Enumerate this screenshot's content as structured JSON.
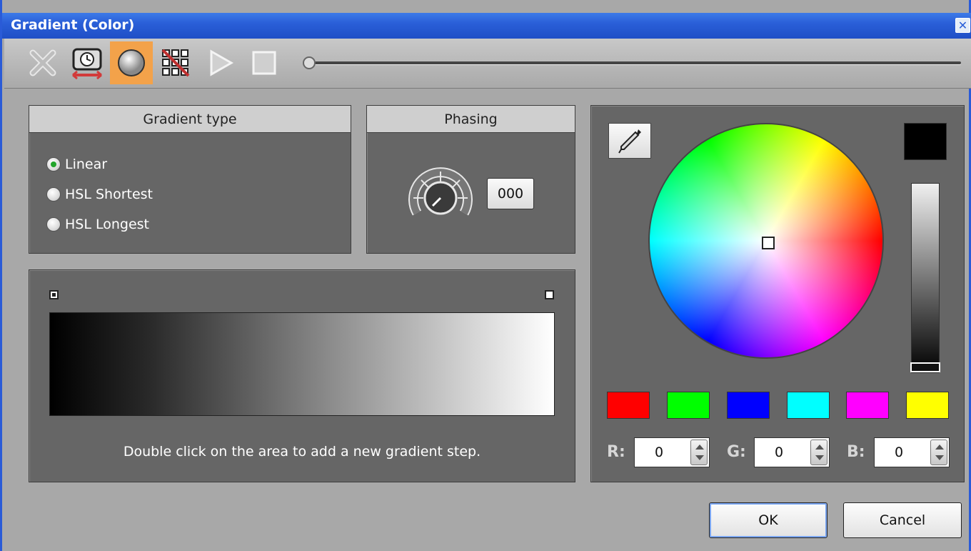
{
  "window": {
    "title": "Gradient (Color)",
    "close_glyph": "✕"
  },
  "toolbar": {
    "icons": [
      "delete-icon",
      "timer-icon",
      "gradient-icon",
      "pattern-icon",
      "play-icon",
      "stop-icon"
    ],
    "active": "gradient-icon",
    "slider_value": 0
  },
  "gradient_type": {
    "header": "Gradient type",
    "options": [
      {
        "label": "Linear",
        "selected": true
      },
      {
        "label": "HSL Shortest",
        "selected": false
      },
      {
        "label": "HSL Longest",
        "selected": false
      }
    ]
  },
  "phasing": {
    "header": "Phasing",
    "value": "000"
  },
  "gradient_editor": {
    "hint": "Double click on the area to add a new gradient step.",
    "stops": [
      {
        "color": "#000000",
        "selected": true
      },
      {
        "color": "#ffffff",
        "selected": false
      }
    ]
  },
  "color_picker": {
    "current_color": "#000000",
    "swatches": [
      "#ff0000",
      "#00ff00",
      "#0000ff",
      "#00ffff",
      "#ff00ff",
      "#ffff00"
    ],
    "r_label": "R:",
    "r_value": "0",
    "g_label": "G:",
    "g_value": "0",
    "b_label": "B:",
    "b_value": "0"
  },
  "buttons": {
    "ok": "OK",
    "cancel": "Cancel"
  }
}
